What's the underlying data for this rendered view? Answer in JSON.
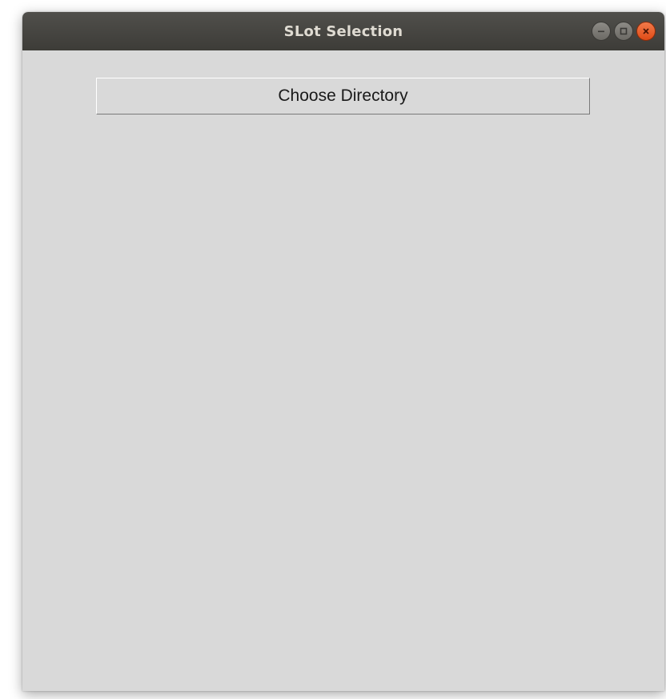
{
  "window": {
    "title": "SLot Selection",
    "controls": {
      "minimize_icon": "minimize-icon",
      "maximize_icon": "maximize-icon",
      "close_icon": "close-icon"
    }
  },
  "main": {
    "choose_directory_label": "Choose Directory"
  },
  "colors": {
    "titlebar": "#45443f",
    "window_background": "#d9d9d9",
    "close_button": "#e95420"
  }
}
